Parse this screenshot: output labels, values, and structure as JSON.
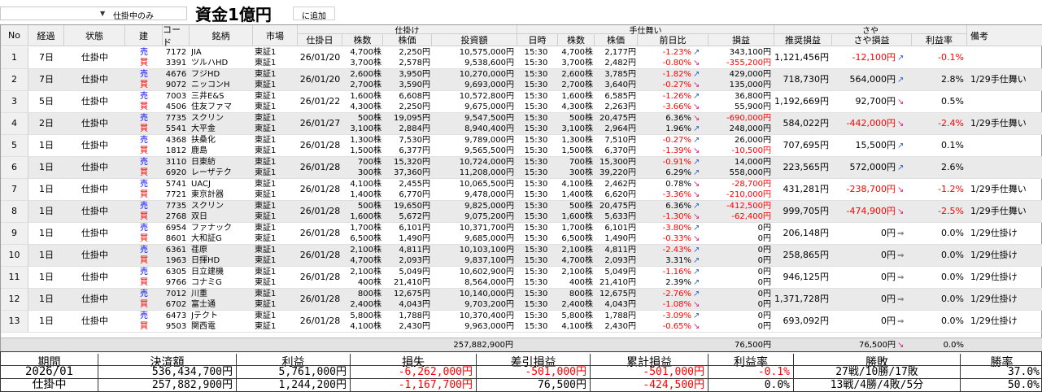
{
  "toolbar": {
    "filter_value": "仕掛中のみ",
    "overlay_title": "資金1億円",
    "add_label": "に追加"
  },
  "headers": {
    "no": "No",
    "keika": "経過",
    "status": "状態",
    "tate": "建",
    "code": "コード",
    "meigara": "銘柄",
    "market": "市場",
    "group_shikake": "仕掛け",
    "group_jijimai": "手仕舞い",
    "group_saya": "さや",
    "biko": "備考",
    "date": "仕掛日",
    "kabusu": "株数",
    "kabuka": "株価",
    "toushi": "投資額",
    "jikan": "日時",
    "kabusu2": "株数",
    "kabuka2": "株価",
    "zenjitsu": "前日比",
    "soneki": "損益",
    "suisho": "推奨損益",
    "saya_soneki": "さや損益",
    "rieki_ritsu": "利益率"
  },
  "rows": [
    {
      "no": "1",
      "keika": "7日",
      "status": "仕掛中",
      "date": "26/01/20",
      "saya_suisho": "1,121,456円",
      "saya_soneki": "-12,100円",
      "saya_dir": "up",
      "rate": "-0.1%",
      "note": "",
      "legs": [
        {
          "side": "売",
          "code": "7172",
          "name": "JIA",
          "market": "東証1",
          "kabusu": "4,700株",
          "kabuka": "2,250円",
          "toushi": "10,575,000円",
          "time": "15:30",
          "kabusu2": "4,700株",
          "kabuka2": "2,177円",
          "zen": "-1.23%",
          "zen_dir": "up",
          "soneki": "343,100円"
        },
        {
          "side": "買",
          "code": "3391",
          "name": "ツルハHD",
          "market": "東証1",
          "kabusu": "3,700株",
          "kabuka": "2,578円",
          "toushi": "9,538,600円",
          "time": "15:30",
          "kabusu2": "3,700株",
          "kabuka2": "2,482円",
          "zen": "-0.80%",
          "zen_dir": "down",
          "soneki": "-355,200円"
        }
      ]
    },
    {
      "no": "2",
      "keika": "7日",
      "status": "仕掛中",
      "date": "26/01/20",
      "saya_suisho": "718,730円",
      "saya_soneki": "564,000円",
      "saya_dir": "up",
      "rate": "2.8%",
      "note": "1/29手仕舞い",
      "legs": [
        {
          "side": "売",
          "code": "4676",
          "name": "フジHD",
          "market": "東証1",
          "kabusu": "2,600株",
          "kabuka": "3,950円",
          "toushi": "10,270,000円",
          "time": "15:30",
          "kabusu2": "2,600株",
          "kabuka2": "3,785円",
          "zen": "-1.82%",
          "zen_dir": "up",
          "soneki": "429,000円"
        },
        {
          "side": "買",
          "code": "9072",
          "name": "ニッコンH",
          "market": "東証1",
          "kabusu": "2,700株",
          "kabuka": "3,590円",
          "toushi": "9,693,000円",
          "time": "15:30",
          "kabusu2": "2,700株",
          "kabuka2": "3,640円",
          "zen": "-0.27%",
          "zen_dir": "down",
          "soneki": "135,000円"
        }
      ]
    },
    {
      "no": "3",
      "keika": "5日",
      "status": "仕掛中",
      "date": "26/01/22",
      "saya_suisho": "1,192,669円",
      "saya_soneki": "92,700円",
      "saya_dir": "down",
      "rate": "0.5%",
      "note": "",
      "legs": [
        {
          "side": "売",
          "code": "7003",
          "name": "三井E&S",
          "market": "東証1",
          "kabusu": "1,600株",
          "kabuka": "6,608円",
          "toushi": "10,572,800円",
          "time": "15:30",
          "kabusu2": "1,600株",
          "kabuka2": "6,585円",
          "zen": "-1.26%",
          "zen_dir": "up",
          "soneki": "36,800円"
        },
        {
          "side": "買",
          "code": "4506",
          "name": "住友ファマ",
          "market": "東証1",
          "kabusu": "4,300株",
          "kabuka": "2,250円",
          "toushi": "9,675,000円",
          "time": "15:30",
          "kabusu2": "4,300株",
          "kabuka2": "2,263円",
          "zen": "-3.66%",
          "zen_dir": "down",
          "soneki": "55,900円"
        }
      ]
    },
    {
      "no": "4",
      "keika": "2日",
      "status": "仕掛中",
      "date": "26/01/27",
      "saya_suisho": "584,022円",
      "saya_soneki": "-442,000円",
      "saya_dir": "down",
      "rate": "-2.4%",
      "note": "1/29手仕舞い",
      "legs": [
        {
          "side": "売",
          "code": "7735",
          "name": "スクリン",
          "market": "東証1",
          "kabusu": "500株",
          "kabuka": "19,095円",
          "toushi": "9,547,500円",
          "time": "15:30",
          "kabusu2": "500株",
          "kabuka2": "20,475円",
          "zen": "6.36%",
          "zen_dir": "down",
          "soneki": "-690,000円"
        },
        {
          "side": "買",
          "code": "5541",
          "name": "大平金",
          "market": "東証1",
          "kabusu": "3,100株",
          "kabuka": "2,884円",
          "toushi": "8,940,400円",
          "time": "15:30",
          "kabusu2": "3,100株",
          "kabuka2": "2,964円",
          "zen": "1.96%",
          "zen_dir": "up",
          "soneki": "248,000円"
        }
      ]
    },
    {
      "no": "5",
      "keika": "1日",
      "status": "仕掛中",
      "date": "26/01/28",
      "saya_suisho": "707,695円",
      "saya_soneki": "15,500円",
      "saya_dir": "up",
      "rate": "0.1%",
      "note": "",
      "legs": [
        {
          "side": "売",
          "code": "4368",
          "name": "扶桑化",
          "market": "東証1",
          "kabusu": "1,300株",
          "kabuka": "7,530円",
          "toushi": "9,789,000円",
          "time": "15:30",
          "kabusu2": "1,300株",
          "kabuka2": "7,510円",
          "zen": "-0.27%",
          "zen_dir": "up",
          "soneki": "26,000円"
        },
        {
          "side": "買",
          "code": "1812",
          "name": "鹿島",
          "market": "東証1",
          "kabusu": "1,500株",
          "kabuka": "6,377円",
          "toushi": "9,565,500円",
          "time": "15:30",
          "kabusu2": "1,500株",
          "kabuka2": "6,370円",
          "zen": "-1.39%",
          "zen_dir": "down",
          "soneki": "-10,500円"
        }
      ]
    },
    {
      "no": "6",
      "keika": "1日",
      "status": "仕掛中",
      "date": "26/01/28",
      "saya_suisho": "223,565円",
      "saya_soneki": "572,000円",
      "saya_dir": "up",
      "rate": "2.6%",
      "note": "",
      "legs": [
        {
          "side": "売",
          "code": "3110",
          "name": "日東紡",
          "market": "東証1",
          "kabusu": "700株",
          "kabuka": "15,320円",
          "toushi": "10,724,000円",
          "time": "15:30",
          "kabusu2": "700株",
          "kabuka2": "15,300円",
          "zen": "-0.91%",
          "zen_dir": "up",
          "soneki": "14,000円"
        },
        {
          "side": "買",
          "code": "6920",
          "name": "レーザテク",
          "market": "東証1",
          "kabusu": "300株",
          "kabuka": "37,360円",
          "toushi": "11,208,000円",
          "time": "15:30",
          "kabusu2": "300株",
          "kabuka2": "39,220円",
          "zen": "6.29%",
          "zen_dir": "up",
          "soneki": "558,000円"
        }
      ]
    },
    {
      "no": "7",
      "keika": "1日",
      "status": "仕掛中",
      "date": "26/01/28",
      "saya_suisho": "431,281円",
      "saya_soneki": "-238,700円",
      "saya_dir": "down",
      "rate": "-1.2%",
      "note": "1/29手仕舞い",
      "legs": [
        {
          "side": "売",
          "code": "5741",
          "name": "UACJ",
          "market": "東証1",
          "kabusu": "4,100株",
          "kabuka": "2,455円",
          "toushi": "10,065,500円",
          "time": "15:30",
          "kabusu2": "4,100株",
          "kabuka2": "2,462円",
          "zen": "0.78%",
          "zen_dir": "down",
          "soneki": "-28,700円"
        },
        {
          "side": "買",
          "code": "7721",
          "name": "東京計器",
          "market": "東証1",
          "kabusu": "1,400株",
          "kabuka": "6,770円",
          "toushi": "9,478,000円",
          "time": "15:30",
          "kabusu2": "1,400株",
          "kabuka2": "6,620円",
          "zen": "-3.36%",
          "zen_dir": "down",
          "soneki": "-210,000円"
        }
      ]
    },
    {
      "no": "8",
      "keika": "1日",
      "status": "仕掛中",
      "date": "26/01/28",
      "saya_suisho": "999,705円",
      "saya_soneki": "-474,900円",
      "saya_dir": "down",
      "rate": "-2.5%",
      "note": "1/29手仕舞い",
      "legs": [
        {
          "side": "売",
          "code": "7735",
          "name": "スクリン",
          "market": "東証1",
          "kabusu": "500株",
          "kabuka": "19,650円",
          "toushi": "9,825,000円",
          "time": "15:30",
          "kabusu2": "500株",
          "kabuka2": "20,475円",
          "zen": "6.36%",
          "zen_dir": "up",
          "soneki": "-412,500円"
        },
        {
          "side": "買",
          "code": "2768",
          "name": "双日",
          "market": "東証1",
          "kabusu": "1,600株",
          "kabuka": "5,672円",
          "toushi": "9,075,200円",
          "time": "15:30",
          "kabusu2": "1,600株",
          "kabuka2": "5,633円",
          "zen": "-1.30%",
          "zen_dir": "down",
          "soneki": "-62,400円"
        }
      ]
    },
    {
      "no": "9",
      "keika": "1日",
      "status": "仕掛中",
      "date": "26/01/28",
      "saya_suisho": "206,148円",
      "saya_soneki": "0円",
      "saya_dir": "flat",
      "rate": "0.0%",
      "note": "1/29仕掛け",
      "legs": [
        {
          "side": "売",
          "code": "6954",
          "name": "ファナック",
          "market": "東証1",
          "kabusu": "1,700株",
          "kabuka": "6,101円",
          "toushi": "10,371,700円",
          "time": "15:30",
          "kabusu2": "1,700株",
          "kabuka2": "6,101円",
          "zen": "-3.80%",
          "zen_dir": "up",
          "soneki": "0円"
        },
        {
          "side": "買",
          "code": "8601",
          "name": "大和証G",
          "market": "東証1",
          "kabusu": "6,500株",
          "kabuka": "1,490円",
          "toushi": "9,685,000円",
          "time": "15:30",
          "kabusu2": "6,500株",
          "kabuka2": "1,490円",
          "zen": "-0.33%",
          "zen_dir": "down",
          "soneki": "0円"
        }
      ]
    },
    {
      "no": "10",
      "keika": "1日",
      "status": "仕掛中",
      "date": "26/01/28",
      "saya_suisho": "258,865円",
      "saya_soneki": "0円",
      "saya_dir": "flat",
      "rate": "0.0%",
      "note": "1/29仕掛け",
      "legs": [
        {
          "side": "売",
          "code": "6361",
          "name": "荏原",
          "market": "東証1",
          "kabusu": "2,100株",
          "kabuka": "4,811円",
          "toushi": "10,103,100円",
          "time": "15:30",
          "kabusu2": "2,100株",
          "kabuka2": "4,811円",
          "zen": "-2.43%",
          "zen_dir": "up",
          "soneki": "0円"
        },
        {
          "side": "買",
          "code": "1963",
          "name": "日揮HD",
          "market": "東証1",
          "kabusu": "4,700株",
          "kabuka": "2,093円",
          "toushi": "9,837,100円",
          "time": "15:30",
          "kabusu2": "4,700株",
          "kabuka2": "2,093円",
          "zen": "3.31%",
          "zen_dir": "up",
          "soneki": "0円"
        }
      ]
    },
    {
      "no": "11",
      "keika": "1日",
      "status": "仕掛中",
      "date": "26/01/28",
      "saya_suisho": "946,125円",
      "saya_soneki": "0円",
      "saya_dir": "flat",
      "rate": "0.0%",
      "note": "1/29仕掛け",
      "legs": [
        {
          "side": "売",
          "code": "6305",
          "name": "日立建機",
          "market": "東証1",
          "kabusu": "2,100株",
          "kabuka": "5,049円",
          "toushi": "10,602,900円",
          "time": "15:30",
          "kabusu2": "2,100株",
          "kabuka2": "5,049円",
          "zen": "-1.16%",
          "zen_dir": "up",
          "soneki": "0円"
        },
        {
          "side": "買",
          "code": "9766",
          "name": "コナミG",
          "market": "東証1",
          "kabusu": "400株",
          "kabuka": "21,410円",
          "toushi": "8,564,000円",
          "time": "15:30",
          "kabusu2": "400株",
          "kabuka2": "21,410円",
          "zen": "2.39%",
          "zen_dir": "up",
          "soneki": "0円"
        }
      ]
    },
    {
      "no": "12",
      "keika": "1日",
      "status": "仕掛中",
      "date": "26/01/28",
      "saya_suisho": "1,371,728円",
      "saya_soneki": "0円",
      "saya_dir": "flat",
      "rate": "0.0%",
      "note": "1/29仕掛け",
      "legs": [
        {
          "side": "売",
          "code": "7012",
          "name": "川重",
          "market": "東証1",
          "kabusu": "800株",
          "kabuka": "12,675円",
          "toushi": "10,140,000円",
          "time": "15:30",
          "kabusu2": "800株",
          "kabuka2": "12,675円",
          "zen": "-2.76%",
          "zen_dir": "up",
          "soneki": "0円"
        },
        {
          "side": "買",
          "code": "6702",
          "name": "富士通",
          "market": "東証1",
          "kabusu": "2,400株",
          "kabuka": "4,043円",
          "toushi": "9,703,200円",
          "time": "15:30",
          "kabusu2": "2,400株",
          "kabuka2": "4,043円",
          "zen": "-1.08%",
          "zen_dir": "down",
          "soneki": "0円"
        }
      ]
    },
    {
      "no": "13",
      "keika": "1日",
      "status": "仕掛中",
      "date": "26/01/28",
      "saya_suisho": "693,092円",
      "saya_soneki": "0円",
      "saya_dir": "flat",
      "rate": "0.0%",
      "note": "1/29仕掛け",
      "legs": [
        {
          "side": "売",
          "code": "6473",
          "name": "Jテクト",
          "market": "東証1",
          "kabusu": "5,800株",
          "kabuka": "1,788円",
          "toushi": "10,370,400円",
          "time": "15:30",
          "kabusu2": "5,800株",
          "kabuka2": "1,788円",
          "zen": "-3.09%",
          "zen_dir": "up",
          "soneki": "0円"
        },
        {
          "side": "買",
          "code": "9503",
          "name": "関西電",
          "market": "東証1",
          "kabusu": "4,100株",
          "kabuka": "2,430円",
          "toushi": "9,963,000円",
          "time": "15:30",
          "kabusu2": "4,100株",
          "kabuka2": "2,430円",
          "zen": "-0.65%",
          "zen_dir": "down",
          "soneki": "0円"
        }
      ]
    }
  ],
  "totals": {
    "toushi": "257,882,900円",
    "soneki": "76,500円",
    "saya_soneki": "76,500円",
    "rate": "0.0%"
  },
  "summary": {
    "headers": [
      "期間",
      "決済額",
      "利益",
      "損失",
      "差引損益",
      "累計損益",
      "利益率",
      "勝敗",
      "勝率"
    ],
    "rows": [
      [
        "2026/01",
        "536,434,700円",
        "5,761,000円",
        "-6,262,000円",
        "-501,000円",
        "-501,000円",
        "-0.1%",
        "27戦/10勝/17敗",
        "37.0%"
      ],
      [
        "仕掛中",
        "257,882,900円",
        "1,244,200円",
        "-1,167,700円",
        "76,500円",
        "-424,500円",
        "0.0%",
        "13戦/4勝/4敗/5分",
        "50.0%"
      ]
    ]
  },
  "colors": {
    "red": "#ff0000",
    "blue": "#0000ff",
    "up_arrow": "#3366cc",
    "down_arrow": "#e0207a",
    "alt_row": "#eaeaea"
  }
}
